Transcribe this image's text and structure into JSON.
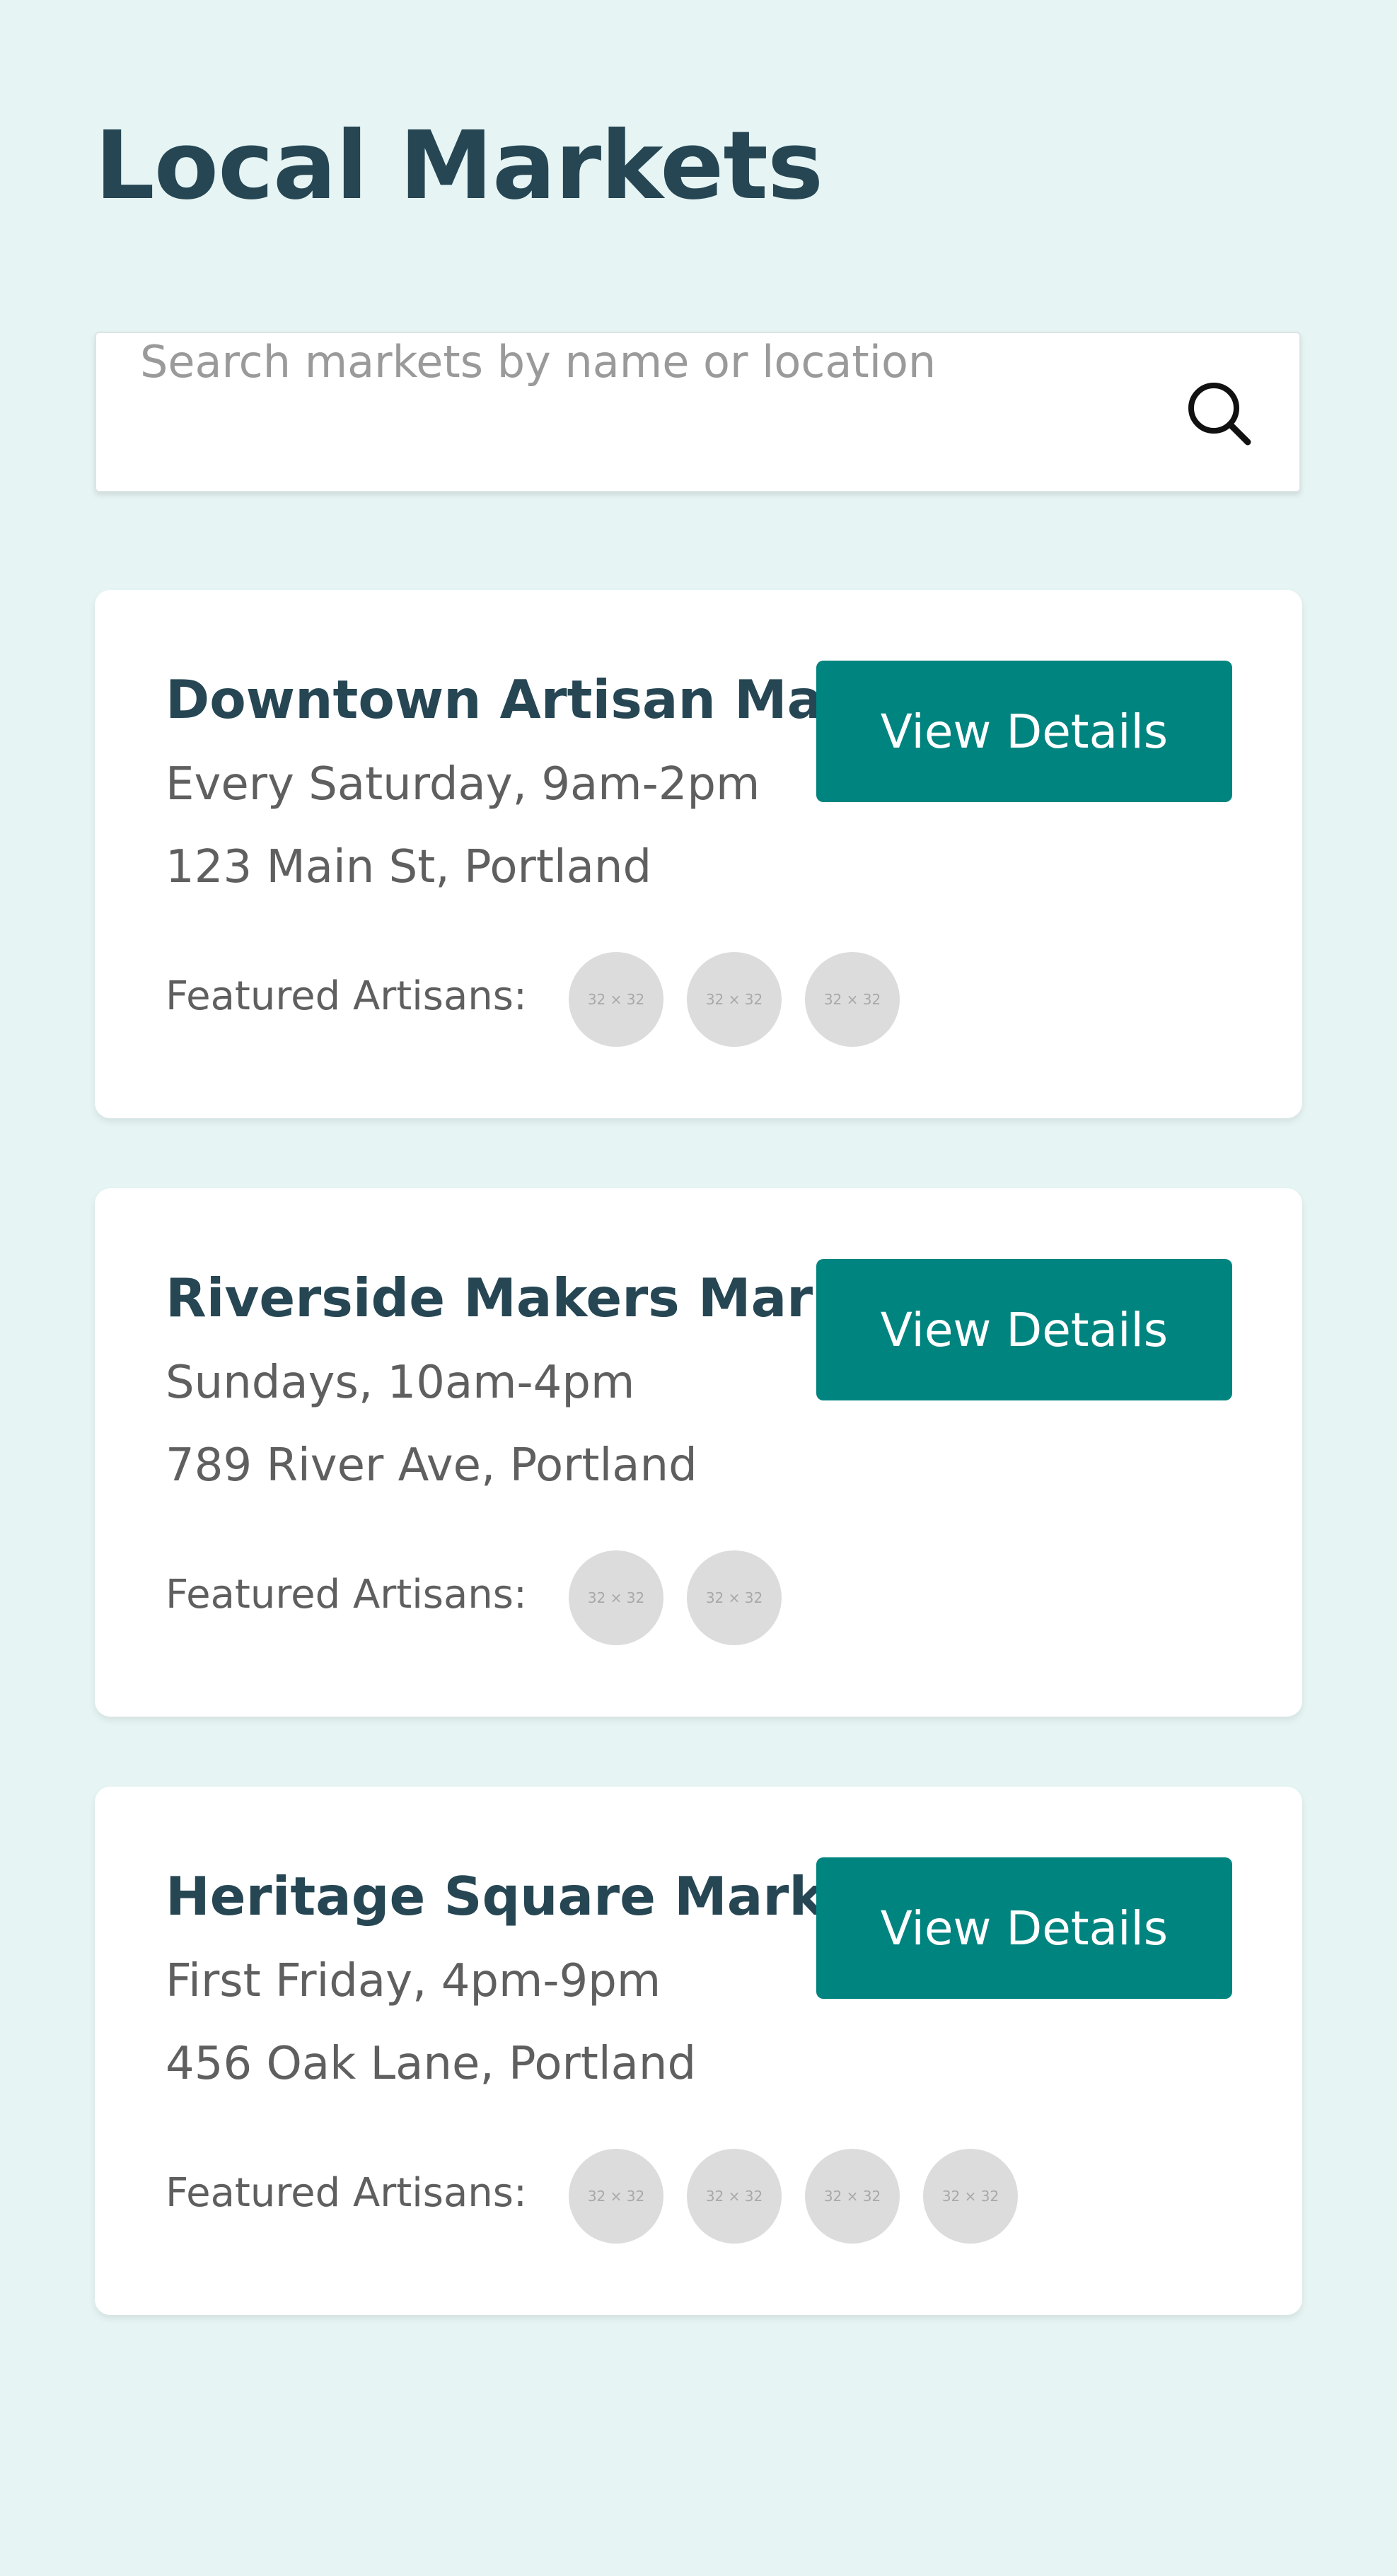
{
  "page": {
    "title": "Local Markets"
  },
  "search": {
    "placeholder": "Search markets by name or location",
    "icon": "search-icon"
  },
  "markets": [
    {
      "name": "Downtown Artisan Market",
      "schedule": "Every Saturday, 9am-2pm",
      "address": "123 Main St, Portland",
      "button_label": "View Details",
      "artisans_label": "Featured Artisans:",
      "avatars": [
        "32 × 32",
        "32 × 32",
        "32 × 32"
      ]
    },
    {
      "name": "Riverside Makers Market",
      "schedule": "Sundays, 10am-4pm",
      "address": "789 River Ave, Portland",
      "button_label": "View Details",
      "artisans_label": "Featured Artisans:",
      "avatars": [
        "32 × 32",
        "32 × 32"
      ]
    },
    {
      "name": "Heritage Square Market",
      "schedule": "First Friday, 4pm-9pm",
      "address": "456 Oak Lane, Portland",
      "button_label": "View Details",
      "artisans_label": "Featured Artisans:",
      "avatars": [
        "32 × 32",
        "32 × 32",
        "32 × 32",
        "32 × 32"
      ]
    }
  ],
  "colors": {
    "background": "#e6f4f4",
    "heading": "#264653",
    "accent": "#00847f",
    "card": "#ffffff",
    "muted_text": "#5f5f5f",
    "avatar_placeholder": "#dcdcdc"
  }
}
